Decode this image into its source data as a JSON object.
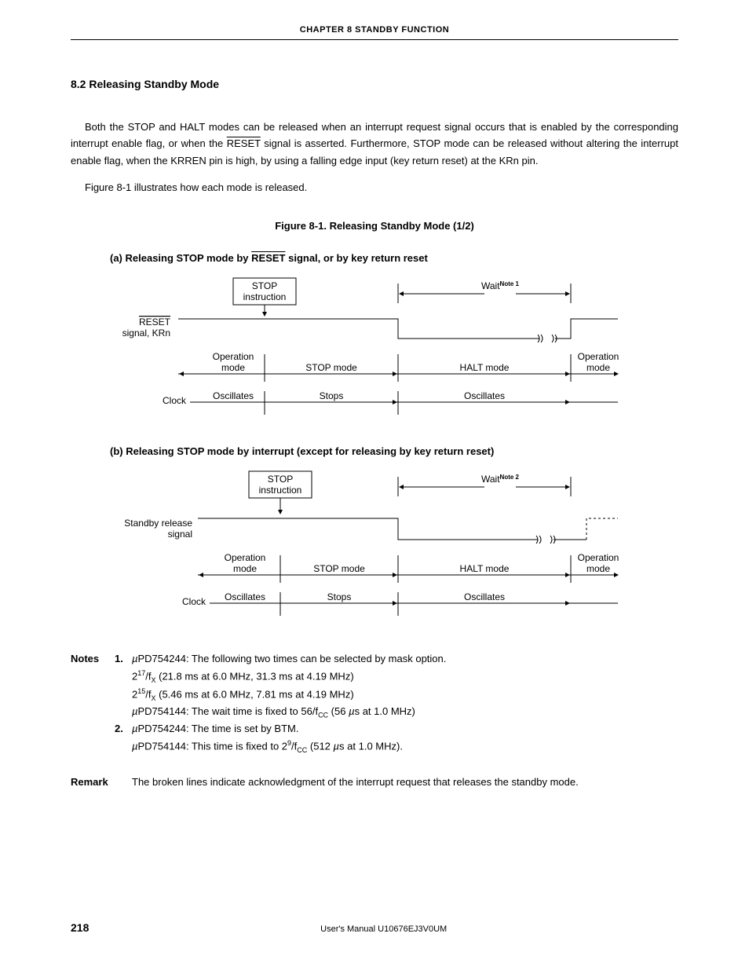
{
  "chapter_header": "CHAPTER 8   STANDBY FUNCTION",
  "section_title": "8.2  Releasing Standby Mode",
  "para1_a": "Both the STOP and HALT modes can be released when an interrupt request signal occurs that is enabled by the corresponding interrupt enable flag, or when the ",
  "para1_reset": "RESET",
  "para1_b": " signal is asserted.  Furthermore, STOP mode can be released without altering the interrupt enable flag, when the KRREN pin is high, by using a falling edge input (key return reset) at the KRn pin.",
  "para2": "Figure 8-1 illustrates how each mode is released.",
  "figure_title": "Figure 8-1.  Releasing Standby Mode (1/2)",
  "subfig_a_pre": "(a)  Releasing STOP mode by ",
  "subfig_a_reset": "RESET",
  "subfig_a_post": " signal, or by key return reset",
  "subfig_b": "(b)  Releasing STOP mode by interrupt (except for releasing by key return reset)",
  "diag_a": {
    "stop_instruction_l1": "STOP",
    "stop_instruction_l2": "instruction",
    "wait": "Wait",
    "wait_sup": "Note 1",
    "reset_l1": "RESET",
    "reset_l2": "signal, KRn",
    "op_mode_l1": "Operation",
    "op_mode_l2": "mode",
    "stop_mode": "STOP mode",
    "halt_mode": "HALT mode",
    "clock": "Clock",
    "oscillates": "Oscillates",
    "stops": "Stops"
  },
  "diag_b": {
    "stop_instruction_l1": "STOP",
    "stop_instruction_l2": "instruction",
    "wait": "Wait",
    "wait_sup": "Note 2",
    "standby_l1": "Standby release",
    "standby_l2": "signal",
    "op_mode_l1": "Operation",
    "op_mode_l2": "mode",
    "stop_mode": "STOP mode",
    "halt_mode": "HALT mode",
    "clock": "Clock",
    "oscillates": "Oscillates",
    "stops": "Stops"
  },
  "notes": {
    "label": "Notes",
    "n1_num": "1.",
    "n1_a": "PD754244: The following two times can be selected by mask option.",
    "n1_l2_a": "2",
    "n1_l2_exp": "17",
    "n1_l2_b": "/f",
    "n1_l2_sub": "X",
    "n1_l2_c": " (21.8 ms at 6.0 MHz, 31.3 ms at 4.19 MHz)",
    "n1_l3_a": "2",
    "n1_l3_exp": "15",
    "n1_l3_b": "/f",
    "n1_l3_sub": "X",
    "n1_l3_c": " (5.46 ms at 6.0 MHz, 7.81 ms at 4.19 MHz)",
    "n1_l4_a": "PD754144: The wait time is fixed to 56/f",
    "n1_l4_sub": "CC",
    "n1_l4_b": " (56 ",
    "n1_l4_c": "s at 1.0 MHz)",
    "n2_num": "2.",
    "n2_a": "PD754244: The time is set by BTM.",
    "n2_l2_a": "PD754144: This time is fixed to 2",
    "n2_l2_exp": "9",
    "n2_l2_b": "/f",
    "n2_l2_sub": "CC",
    "n2_l2_c": " (512 ",
    "n2_l2_d": "s at 1.0 MHz)."
  },
  "remark": {
    "label": "Remark",
    "text": "The broken lines indicate acknowledgment of the interrupt request that releases the standby mode."
  },
  "footer": {
    "page": "218",
    "center": "User's Manual  U10676EJ3V0UM"
  },
  "mu_char": "µ"
}
